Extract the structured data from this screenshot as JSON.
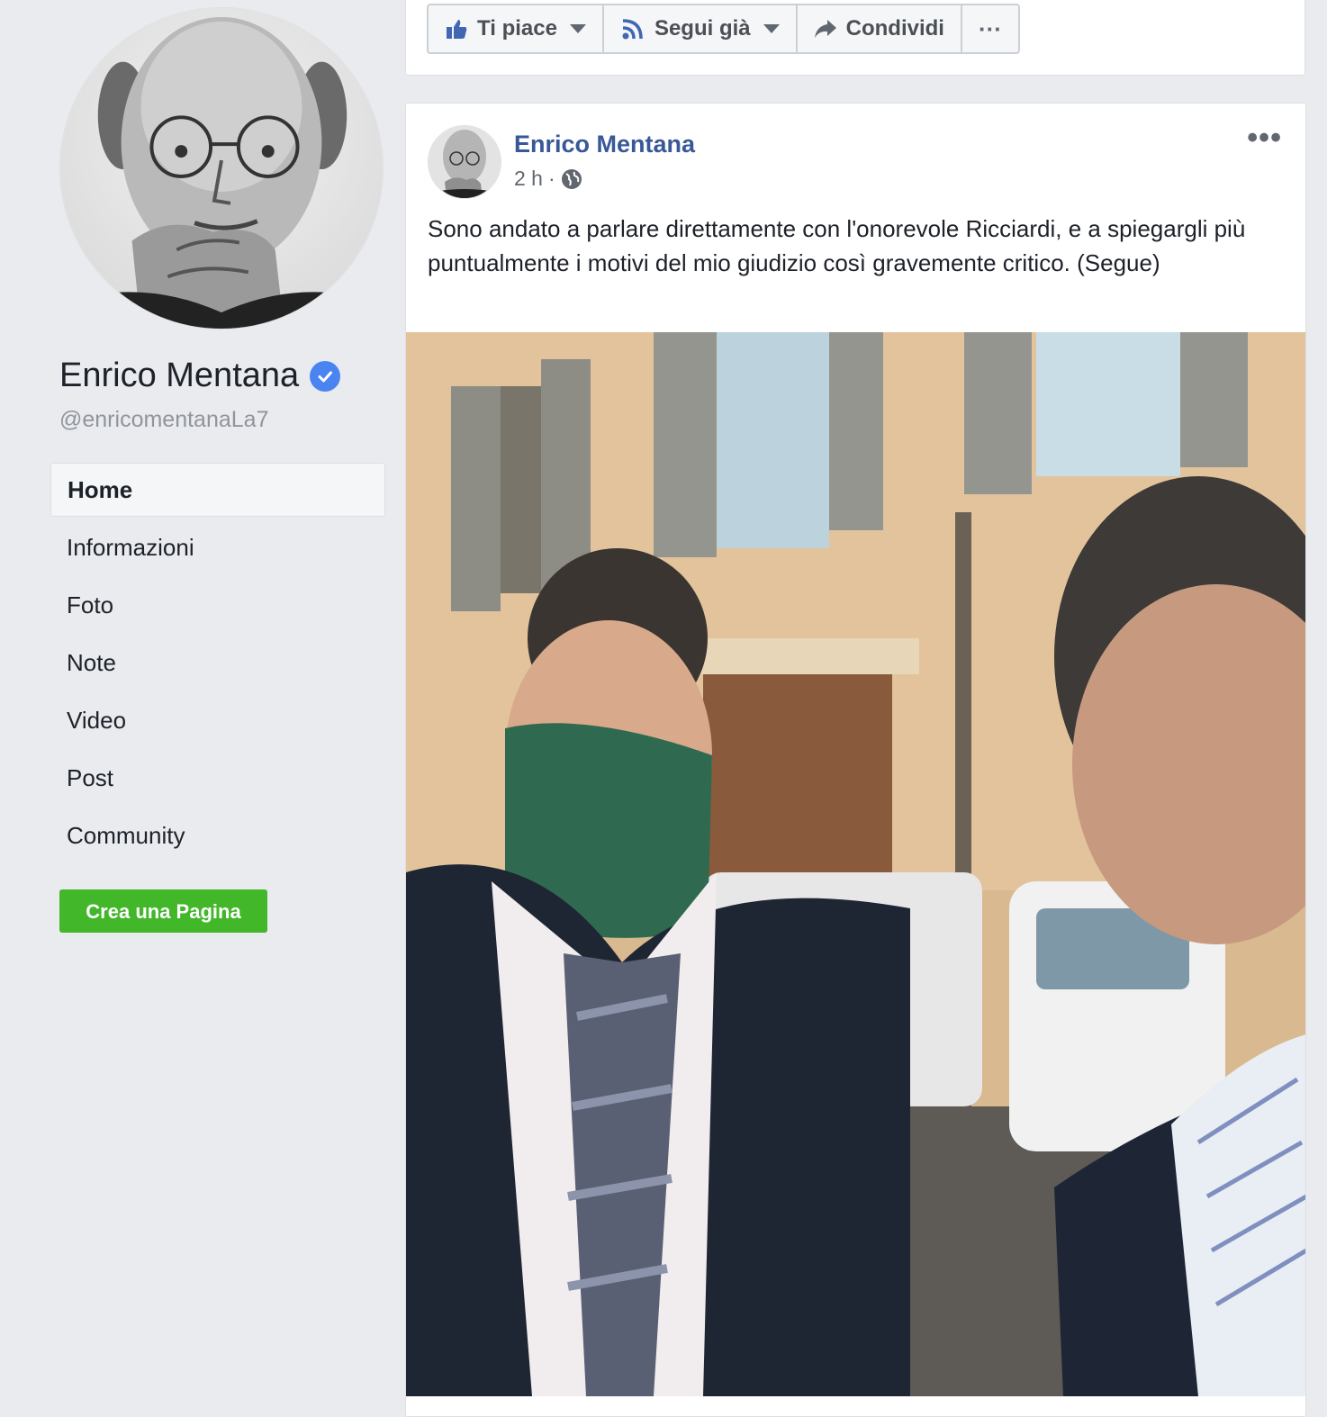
{
  "profile": {
    "name": "Enrico Mentana",
    "handle": "@enricomentanaLa7",
    "verified": true
  },
  "nav": {
    "items": [
      {
        "label": "Home",
        "active": true
      },
      {
        "label": "Informazioni"
      },
      {
        "label": "Foto"
      },
      {
        "label": "Note"
      },
      {
        "label": "Video"
      },
      {
        "label": "Post"
      },
      {
        "label": "Community"
      }
    ],
    "create_page_label": "Crea una Pagina"
  },
  "actions": {
    "like_label": "Ti piace",
    "follow_label": "Segui già",
    "share_label": "Condividi",
    "more_label": "···"
  },
  "post": {
    "author": "Enrico Mentana",
    "time": "2 h",
    "separator": "·",
    "text": "Sono andato a parlare direttamente con l'onorevole Ricciardi, e a spiegargli più puntualmente i motivi del mio giudizio così gravemente critico. (Segue)",
    "more_label": "•••"
  },
  "colors": {
    "background": "#e9ebee",
    "link": "#385898",
    "verified": "#4a84f0",
    "create_button": "#42b72a"
  },
  "icons": [
    "thumbs-up-icon",
    "rss-icon",
    "share-arrow-icon",
    "more-icon",
    "verified-badge-icon",
    "globe-icon"
  ]
}
